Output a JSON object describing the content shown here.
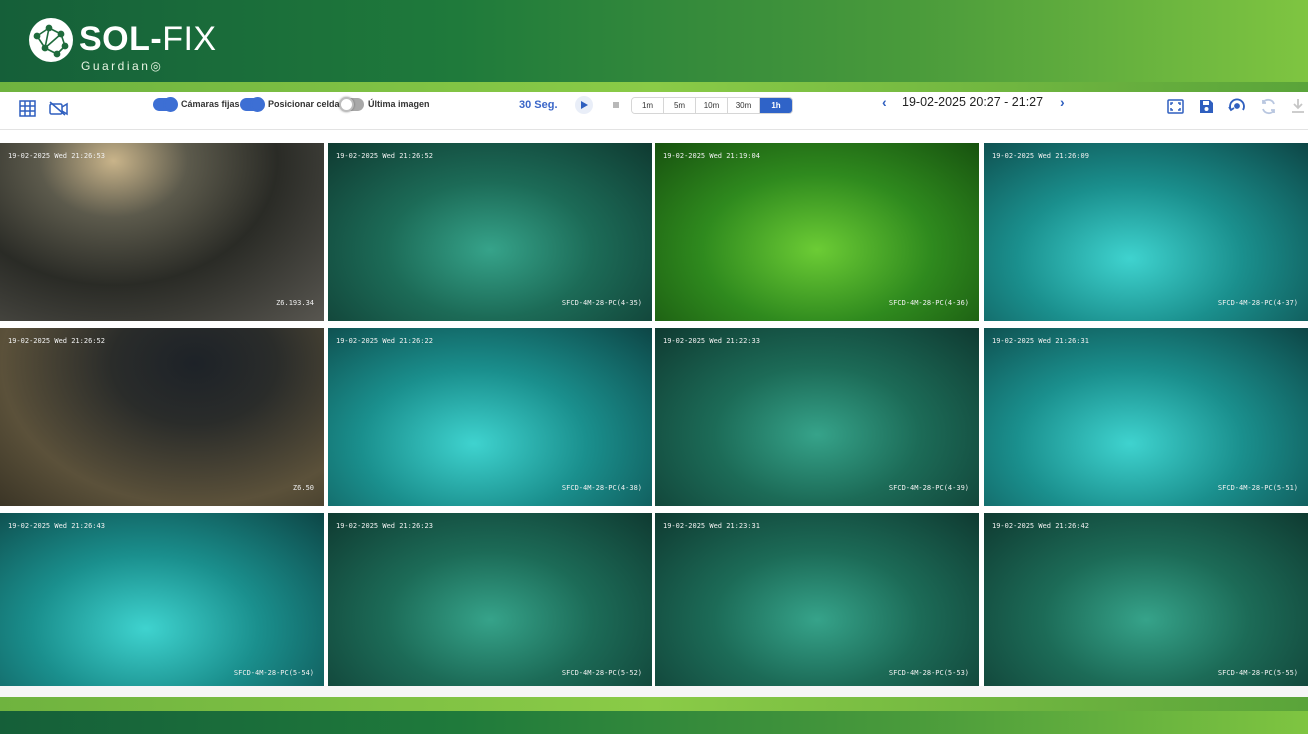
{
  "brand": {
    "name_bold": "SOL-",
    "name_thin": "FIX",
    "subtitle": "Guardian"
  },
  "toolbar": {
    "toggles": [
      {
        "label": "Cámaras fijas",
        "on": true
      },
      {
        "label": "Posicionar celdas",
        "on": true
      },
      {
        "label": "Última imagen",
        "on": false
      }
    ],
    "interval": "30 Seg.",
    "ranges": [
      "1m",
      "5m",
      "10m",
      "30m",
      "1h"
    ],
    "active_range": "1h",
    "date_range": "19-02-2025 20:27 - 21:27",
    "accent": "#2f63c8"
  },
  "cameras": [
    {
      "timestamp": "19-02-2025 Wed 21:26:53",
      "id": "Z6.193.34",
      "scene": "street-site-color"
    },
    {
      "timestamp": "19-02-2025 Wed 21:26:52",
      "id": "SFCD-4M-28-PC(4-35)",
      "scene": "green-night"
    },
    {
      "timestamp": "19-02-2025 Wed 21:19:04",
      "id": "SFCD-4M-28-PC(4-36)",
      "scene": "green-bright"
    },
    {
      "timestamp": "19-02-2025 Wed 21:26:09",
      "id": "SFCD-4M-28-PC(4-37)",
      "scene": "cyan-night"
    },
    {
      "timestamp": "19-02-2025 Wed 21:26:52",
      "id": "Z6.50",
      "scene": "silo-color"
    },
    {
      "timestamp": "19-02-2025 Wed 21:26:22",
      "id": "SFCD-4M-28-PC(4-38)",
      "scene": "cyan-night"
    },
    {
      "timestamp": "19-02-2025 Wed 21:22:33",
      "id": "SFCD-4M-28-PC(4-39)",
      "scene": "green-night"
    },
    {
      "timestamp": "19-02-2025 Wed 21:26:31",
      "id": "SFCD-4M-28-PC(5-51)",
      "scene": "cyan-night"
    },
    {
      "timestamp": "19-02-2025 Wed 21:26:43",
      "id": "SFCD-4M-28-PC(5-54)",
      "scene": "cyan-night"
    },
    {
      "timestamp": "19-02-2025 Wed 21:26:23",
      "id": "SFCD-4M-28-PC(5-52)",
      "scene": "green-night"
    },
    {
      "timestamp": "19-02-2025 Wed 21:23:31",
      "id": "SFCD-4M-28-PC(5-53)",
      "scene": "green-night"
    },
    {
      "timestamp": "19-02-2025 Wed 21:26:42",
      "id": "SFCD-4M-28-PC(5-55)",
      "scene": "green-night"
    }
  ]
}
